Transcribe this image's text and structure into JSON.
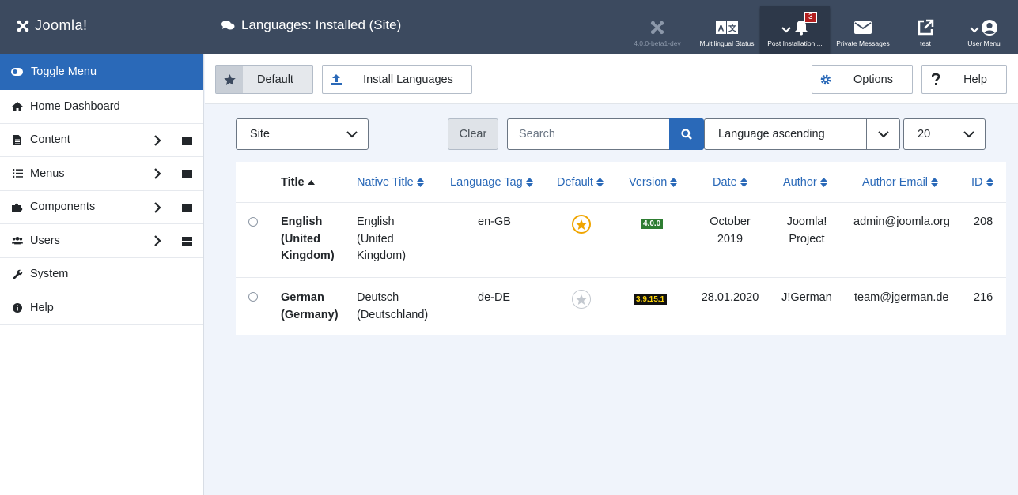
{
  "header": {
    "logo_text": "Joomla!",
    "page_title": "Languages: Installed (Site)",
    "items": [
      {
        "label": "4.0.0-beta1-dev",
        "icon": "joomla-icon"
      },
      {
        "label": "Multilingual Status",
        "icon": "language-icon"
      },
      {
        "label": "Post Installation ...",
        "icon": "bell-icon",
        "badge": "3"
      },
      {
        "label": "Private Messages",
        "icon": "envelope-icon"
      },
      {
        "label": "test",
        "icon": "external-link-icon"
      },
      {
        "label": "User Menu",
        "icon": "user-circle-icon"
      }
    ]
  },
  "sidebar": {
    "toggle_label": "Toggle Menu",
    "items": [
      {
        "label": "Home Dashboard",
        "icon": "home-icon"
      },
      {
        "label": "Content",
        "icon": "file-icon"
      },
      {
        "label": "Menus",
        "icon": "list-icon"
      },
      {
        "label": "Components",
        "icon": "puzzle-icon"
      },
      {
        "label": "Users",
        "icon": "users-icon"
      },
      {
        "label": "System",
        "icon": "wrench-icon"
      },
      {
        "label": "Help",
        "icon": "info-icon"
      }
    ]
  },
  "toolbar": {
    "default_label": "Default",
    "install_label": "Install Languages",
    "options_label": "Options",
    "help_label": "Help"
  },
  "filters": {
    "client": "Site",
    "clear_label": "Clear",
    "search_placeholder": "Search",
    "ordering": "Language ascending",
    "limit": "20"
  },
  "table": {
    "headers": [
      "Title",
      "Native Title",
      "Language Tag",
      "Default",
      "Version",
      "Date",
      "Author",
      "Author Email",
      "ID"
    ],
    "rows": [
      {
        "title": [
          "English",
          "(United",
          "Kingdom)"
        ],
        "native": [
          "English",
          "(United",
          "Kingdom)"
        ],
        "tag": "en-GB",
        "is_default": true,
        "version": "4.0.0",
        "date": [
          "October",
          "2019"
        ],
        "author": [
          "Joomla!",
          "Project"
        ],
        "email": "admin@joomla.org",
        "id": "208"
      },
      {
        "title": [
          "German",
          "(Germany)"
        ],
        "native": [
          "Deutsch",
          "(Deutschland)"
        ],
        "tag": "de-DE",
        "is_default": false,
        "version": "3.9.15.1",
        "date": [
          "28.01.2020"
        ],
        "author": [
          "J!German"
        ],
        "email": "team@jgerman.de",
        "id": "216"
      }
    ]
  },
  "colors": {
    "header_bg": "#3c4a5f",
    "accent": "#2a69b8",
    "default_star": "#f0a500"
  }
}
